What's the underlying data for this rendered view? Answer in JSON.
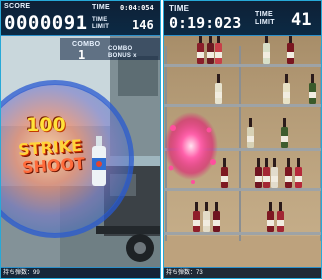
{
  "left_panel": {
    "score_label": "SCORE",
    "score_value": "0000091",
    "time_label": "TIME",
    "time_value": "0:04:054",
    "time_limit_label_1": "TIME",
    "time_limit_label_2": "LIMIT",
    "time_limit_value": "146",
    "combo_label": "COMBO",
    "combo_value": "1",
    "bonus_label_1": "COMBO",
    "bonus_label_2": "BONUS",
    "bonus_mark": "x",
    "points_popup": "100",
    "strike_text": "STRIKE",
    "shoot_text": "SHOOT",
    "footer_text": "持ち弾数：99"
  },
  "right_panel": {
    "time_label": "TIME",
    "time_value": "0:19:023",
    "time_limit_label_1": "TIME",
    "time_limit_label_2": "LIMIT",
    "time_limit_value": "41",
    "footer_text": "持ち弾数：73"
  },
  "colors": {
    "hud_background": "#0e2036",
    "hud_accent": "#2b8fc9",
    "popup_yellow": "#ffe23a",
    "popup_orange": "#ff6b3b"
  }
}
